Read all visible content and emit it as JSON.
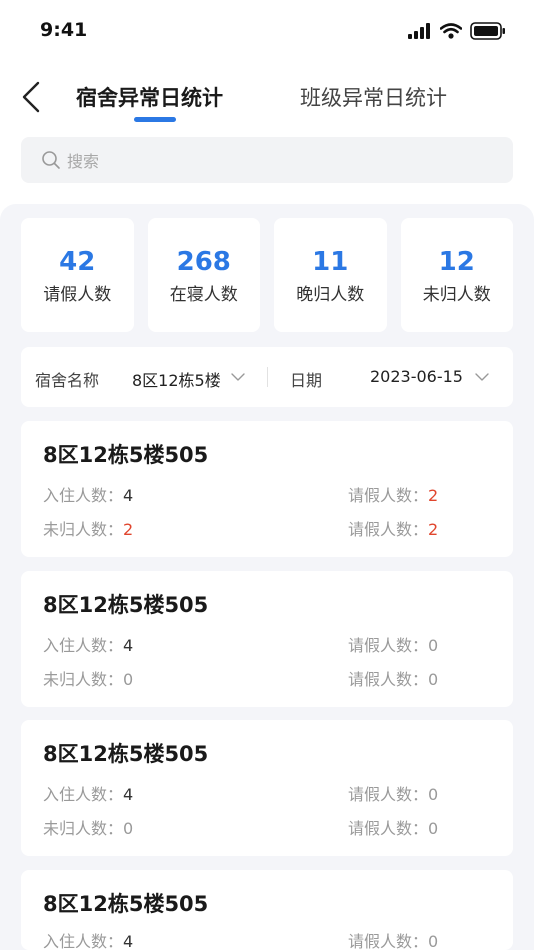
{
  "status": {
    "time": "9:41"
  },
  "nav": {
    "tabs": [
      {
        "label": "宿舍异常日统计",
        "active": true
      },
      {
        "label": "班级异常日统计",
        "active": false
      }
    ]
  },
  "search": {
    "placeholder": "搜索"
  },
  "stats": [
    {
      "value": "42",
      "label": "请假人数"
    },
    {
      "value": "268",
      "label": "在寝人数"
    },
    {
      "value": "11",
      "label": "晚归人数"
    },
    {
      "value": "12",
      "label": "未归人数"
    }
  ],
  "filters": {
    "dorm_label": "宿舍名称",
    "dorm_value": "8区12栋5楼",
    "date_label": "日期",
    "date_value": "2023-06-15"
  },
  "dorms": [
    {
      "name": "8区12栋5楼505",
      "field1_label": "入住人数：",
      "field1_value": "4",
      "field2_label": "请假人数：",
      "field2_value": "2",
      "field3_label": "未归人数：",
      "field3_value": "2",
      "field4_label": "请假人数：",
      "field4_value": "2"
    },
    {
      "name": "8区12栋5楼505",
      "field1_label": "入住人数：",
      "field1_value": "4",
      "field2_label": "请假人数：",
      "field2_value": "0",
      "field3_label": "未归人数：",
      "field3_value": "0",
      "field4_label": "请假人数：",
      "field4_value": "0"
    },
    {
      "name": "8区12栋5楼505",
      "field1_label": "入住人数：",
      "field1_value": "4",
      "field2_label": "请假人数：",
      "field2_value": "0",
      "field3_label": "未归人数：",
      "field3_value": "0",
      "field4_label": "请假人数：",
      "field4_value": "0"
    },
    {
      "name": "8区12栋5楼505",
      "field1_label": "入住人数：",
      "field1_value": "4",
      "field2_label": "请假人数：",
      "field2_value": "0"
    }
  ],
  "colors": {
    "accent": "#2b78e4",
    "alert": "#e0452d"
  }
}
